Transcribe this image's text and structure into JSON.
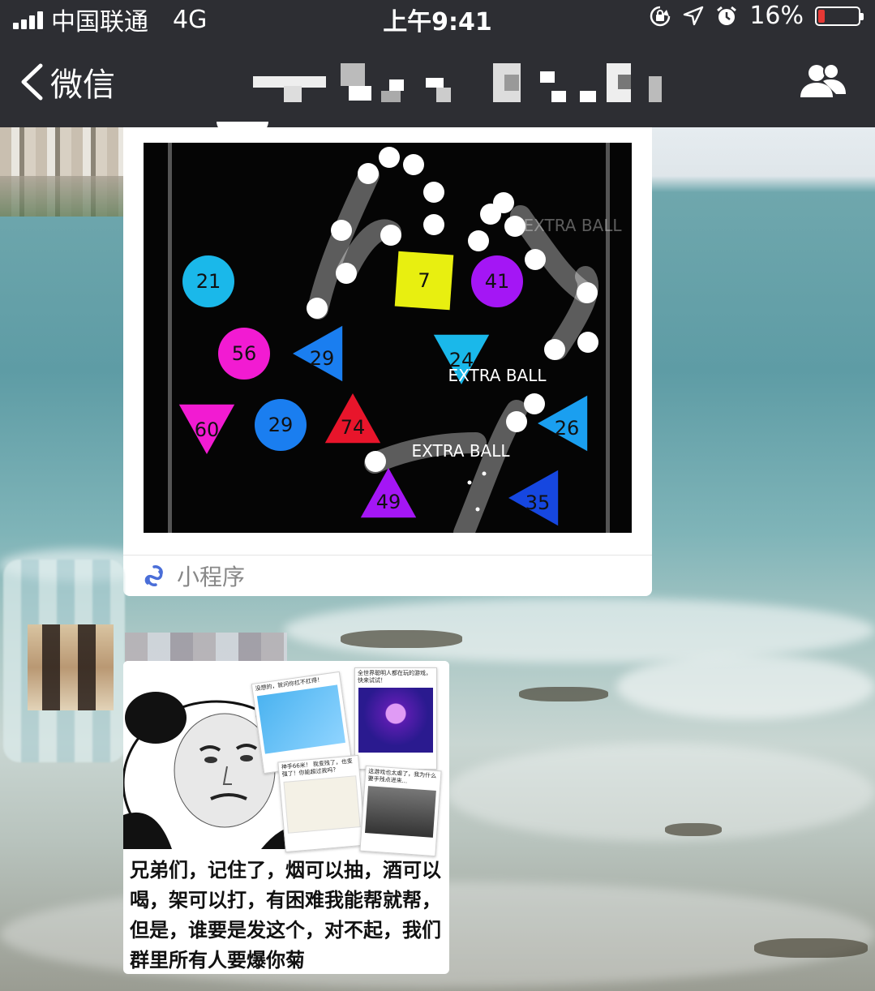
{
  "status_bar": {
    "carrier": "中国联通",
    "network": "4G",
    "time": "上午9:41",
    "battery_percent": "16%",
    "battery_level": 0.16
  },
  "nav": {
    "back_label": "微信",
    "colors": {
      "bar": "#2d2e33",
      "text": "#ffffff"
    }
  },
  "mini_program": {
    "footer_label": "小程序",
    "game": {
      "circles": [
        {
          "label": "21",
          "color": "#1ab8ea"
        },
        {
          "label": "41",
          "color": "#a416f5"
        },
        {
          "label": "56",
          "color": "#f21bd2"
        },
        {
          "label": "29",
          "color": "#1a7ef0"
        }
      ],
      "squares": [
        {
          "label": "7",
          "color": "#e8ef10"
        }
      ],
      "triangles": [
        {
          "label": "29",
          "color": "#1a7ef0"
        },
        {
          "label": "24",
          "color": "#1ab8ea"
        },
        {
          "label": "60",
          "color": "#f21bd2"
        },
        {
          "label": "74",
          "color": "#e8152b"
        },
        {
          "label": "26",
          "color": "#1a9ff0"
        },
        {
          "label": "49",
          "color": "#a416f5"
        },
        {
          "label": "35",
          "color": "#1647e0"
        }
      ],
      "extra_ball_texts": [
        "EXTRA BALL",
        "EXTRA BALL",
        "EXTRA BALL"
      ]
    }
  },
  "meme": {
    "caption": "兄弟们，记住了，烟可以抽，酒可以喝，架可以打，有困难我能帮就帮，但是，谁要是发这个，对不起，我们群里所有人要爆你菊",
    "mini_cards": [
      {
        "text": "没想的，就问你扛不扛得！"
      },
      {
        "text": "全世界聪明人都在玩的游戏，快来试试！"
      },
      {
        "text": "神手66米！ 我变残了，也变强了！你能超过我吗？"
      },
      {
        "text": "这游戏也太虐了，我为什么要手残点进来..."
      }
    ]
  }
}
